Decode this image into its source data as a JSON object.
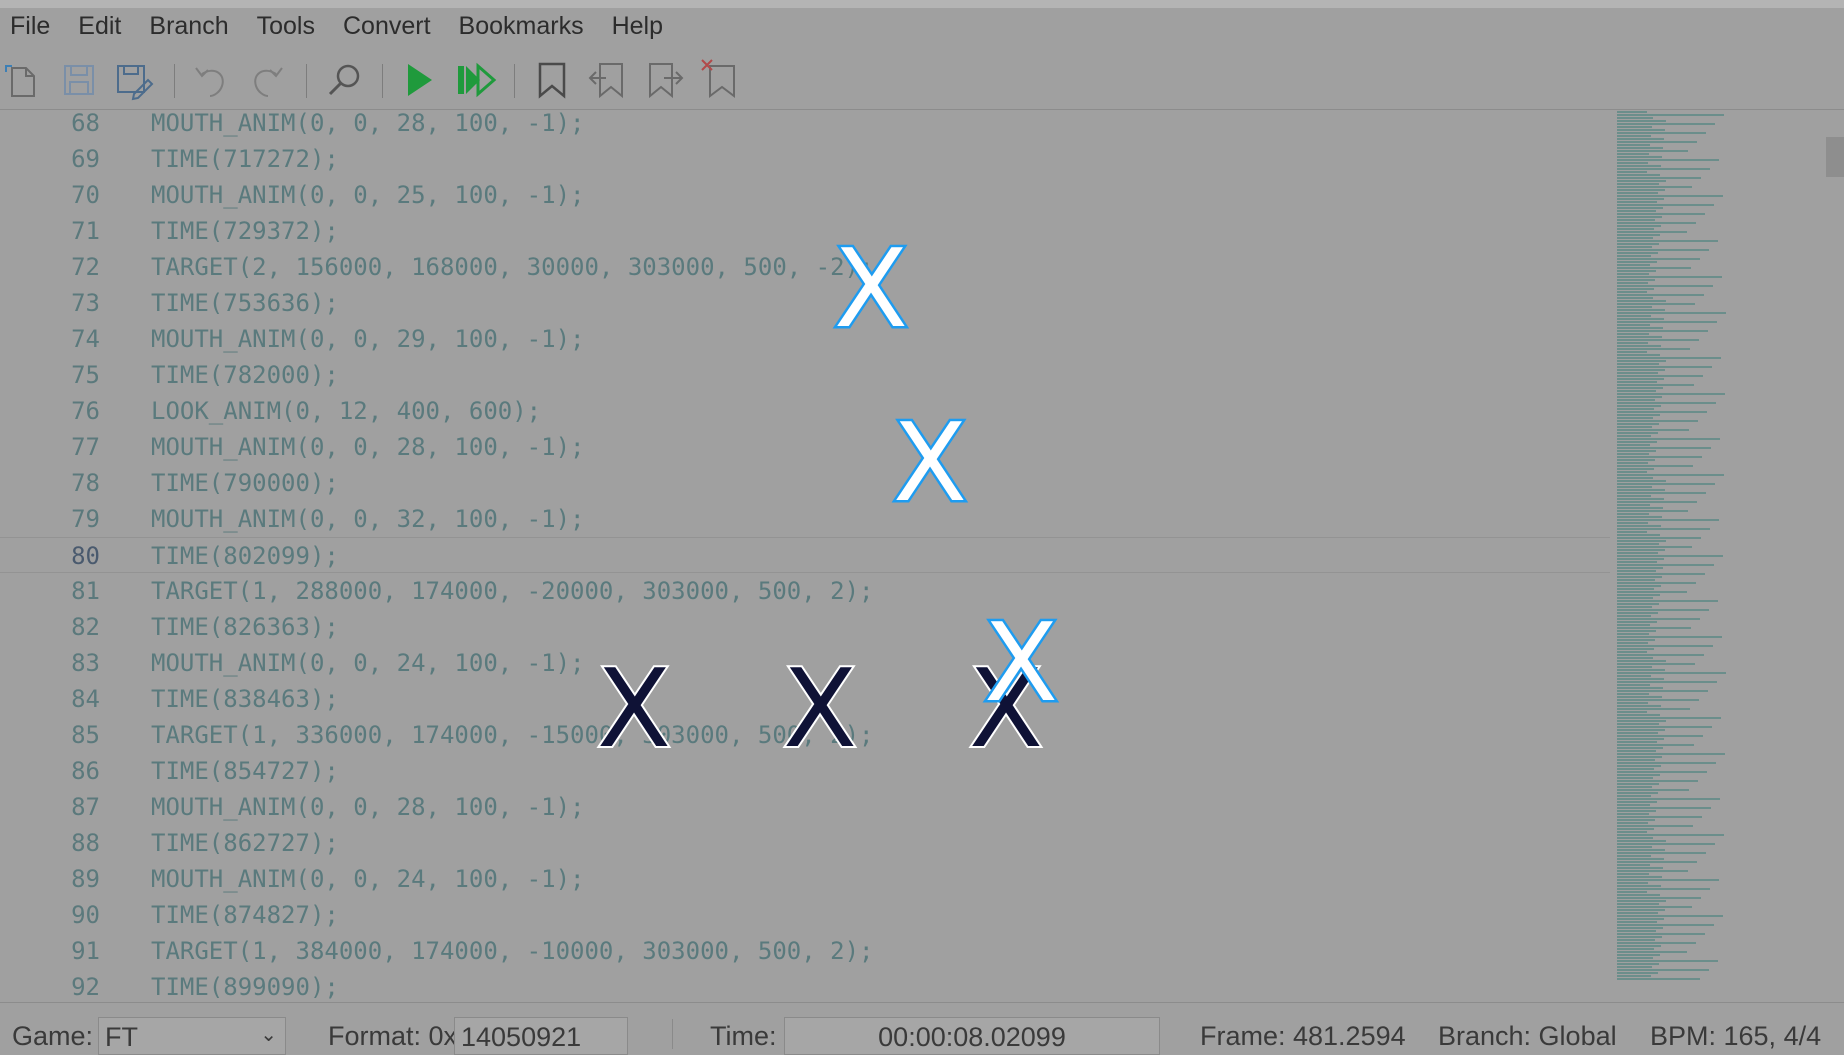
{
  "menu": [
    "File",
    "Edit",
    "Branch",
    "Tools",
    "Convert",
    "Bookmarks",
    "Help"
  ],
  "toolbar_icons": [
    "open-file-icon",
    "save-icon",
    "save-as-icon",
    "undo-icon",
    "redo-icon",
    "search-icon",
    "play-icon",
    "play-from-icon",
    "bookmark-icon",
    "previous-bookmark-icon",
    "next-bookmark-icon",
    "clear-bookmarks-icon"
  ],
  "editor": {
    "current_line": 80,
    "lines": [
      {
        "num": "68",
        "code": "MOUTH_ANIM(0, 0, 28, 100, -1);"
      },
      {
        "num": "69",
        "code": "TIME(717272);"
      },
      {
        "num": "70",
        "code": "MOUTH_ANIM(0, 0, 25, 100, -1);"
      },
      {
        "num": "71",
        "code": "TIME(729372);"
      },
      {
        "num": "72",
        "code": "TARGET(2, 156000, 168000, 30000, 303000, 500, -2);"
      },
      {
        "num": "73",
        "code": "TIME(753636);"
      },
      {
        "num": "74",
        "code": "MOUTH_ANIM(0, 0, 29, 100, -1);"
      },
      {
        "num": "75",
        "code": "TIME(782000);"
      },
      {
        "num": "76",
        "code": "LOOK_ANIM(0, 12, 400, 600);"
      },
      {
        "num": "77",
        "code": "MOUTH_ANIM(0, 0, 28, 100, -1);"
      },
      {
        "num": "78",
        "code": "TIME(790000);"
      },
      {
        "num": "79",
        "code": "MOUTH_ANIM(0, 0, 32, 100, -1);"
      },
      {
        "num": "80",
        "code": "TIME(802099);"
      },
      {
        "num": "81",
        "code": "TARGET(1, 288000, 174000, -20000, 303000, 500, 2);"
      },
      {
        "num": "82",
        "code": "TIME(826363);"
      },
      {
        "num": "83",
        "code": "MOUTH_ANIM(0, 0, 24, 100, -1);"
      },
      {
        "num": "84",
        "code": "TIME(838463);"
      },
      {
        "num": "85",
        "code": "TARGET(1, 336000, 174000, -15000, 303000, 500, 2);"
      },
      {
        "num": "86",
        "code": "TIME(854727);"
      },
      {
        "num": "87",
        "code": "MOUTH_ANIM(0, 0, 28, 100, -1);"
      },
      {
        "num": "88",
        "code": "TIME(862727);"
      },
      {
        "num": "89",
        "code": "MOUTH_ANIM(0, 0, 24, 100, -1);"
      },
      {
        "num": "90",
        "code": "TIME(874827);"
      },
      {
        "num": "91",
        "code": "TARGET(1, 384000, 174000, -10000, 303000, 500, 2);"
      },
      {
        "num": "92",
        "code": "TIME(899090);"
      }
    ]
  },
  "status": {
    "game_label": "Game:",
    "game_value": "FT",
    "format_label": "Format: 0x",
    "format_value": "14050921",
    "time_label": "Time:",
    "time_value": "00:00:08.02099",
    "frame": "Frame: 481.2594",
    "branch": "Branch: Global",
    "bpm": "BPM: 165, 4/4"
  },
  "markers": {
    "symbol": "X",
    "blue_color": "#1e9cf0",
    "dark_color": "#0f1236"
  },
  "colors": {
    "code_text": "#5a7a7d",
    "line_number": "#5b797c",
    "play_green": "#1f9a3c"
  }
}
